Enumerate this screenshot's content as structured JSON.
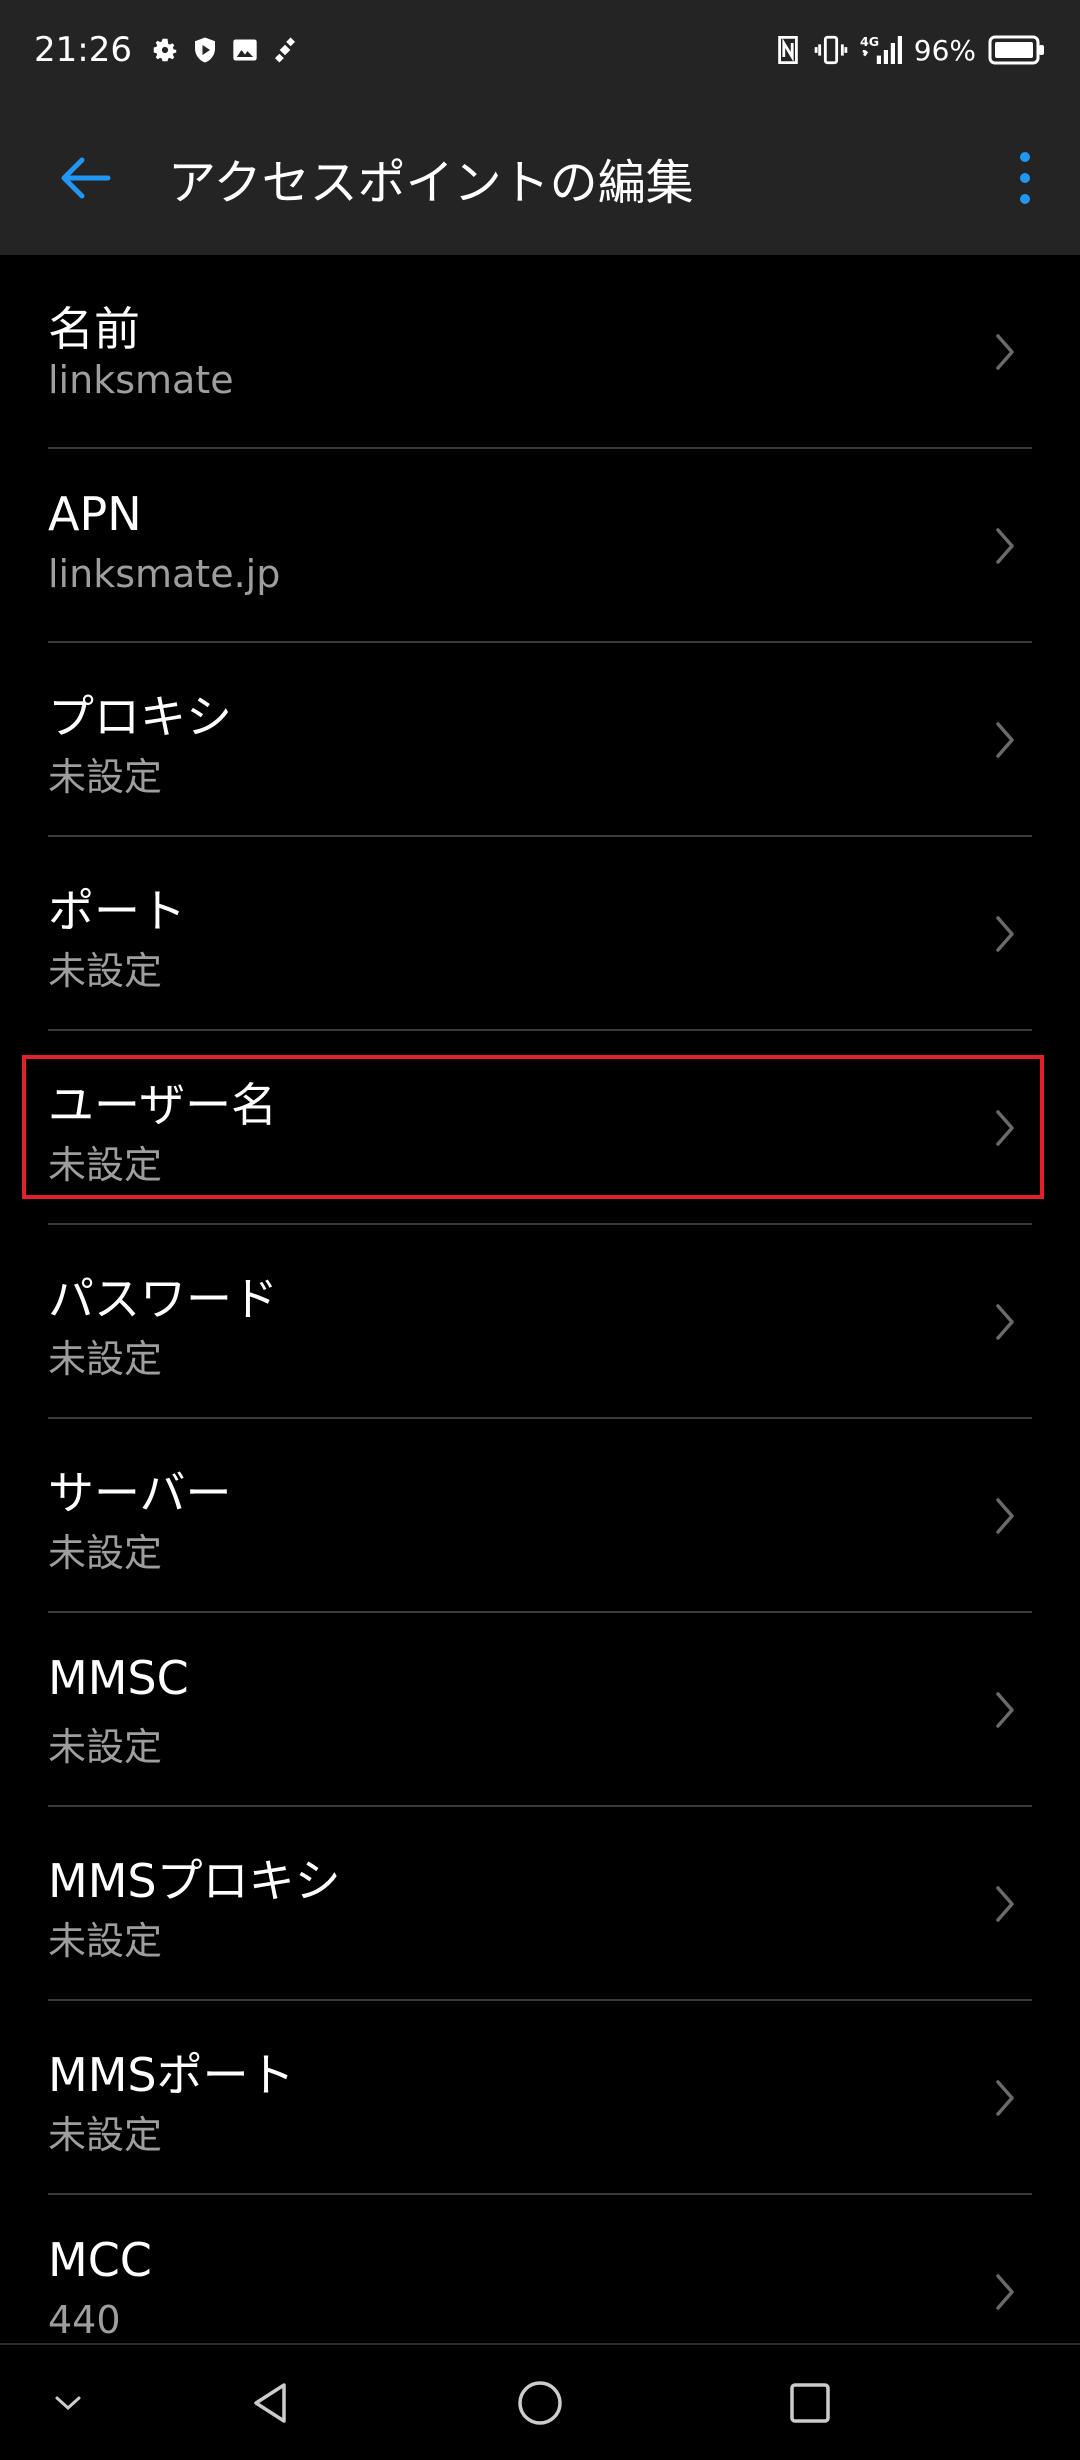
{
  "status_bar": {
    "time": "21:26",
    "battery_percent": "96%",
    "network_type": "4G",
    "icons_left": [
      "gear-icon",
      "shield-play-icon",
      "image-icon",
      "satellite-icon"
    ],
    "icons_right": [
      "nfc-icon",
      "vibrate-icon",
      "signal-icon",
      "battery-icon"
    ]
  },
  "app_bar": {
    "title": "アクセスポイントの編集",
    "accent_color": "#2196f3"
  },
  "settings": [
    {
      "title": "名前",
      "value": "linksmate"
    },
    {
      "title": "APN",
      "value": "linksmate.jp"
    },
    {
      "title": "プロキシ",
      "value": "未設定"
    },
    {
      "title": "ポート",
      "value": "未設定"
    },
    {
      "title": "ユーザー名",
      "value": "未設定"
    },
    {
      "title": "パスワード",
      "value": "未設定"
    },
    {
      "title": "サーバー",
      "value": "未設定"
    },
    {
      "title": "MMSC",
      "value": "未設定"
    },
    {
      "title": "MMSプロキシ",
      "value": "未設定"
    },
    {
      "title": "MMSポート",
      "value": "未設定"
    },
    {
      "title": "MCC",
      "value": "440"
    }
  ],
  "highlight_color": "#e0202a",
  "nav_bar": [
    "collapse-icon",
    "back-triangle-icon",
    "home-circle-icon",
    "recents-square-icon"
  ]
}
